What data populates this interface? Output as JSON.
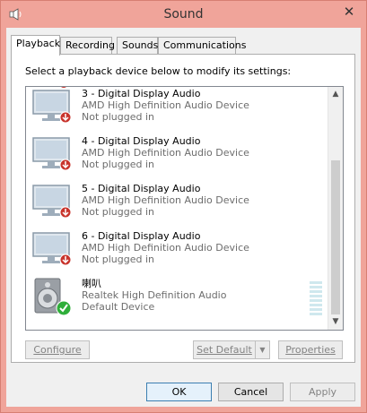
{
  "window": {
    "title": "Sound",
    "close_glyph": "✕"
  },
  "tabs": [
    {
      "label": "Playback",
      "active": true
    },
    {
      "label": "Recording"
    },
    {
      "label": "Sounds"
    },
    {
      "label": "Communications"
    }
  ],
  "instruction": "Select a playback device below to modify its settings:",
  "devices": [
    {
      "name": "3 - Digital Display Audio",
      "driver": "AMD High Definition Audio Device",
      "status": "Not plugged in",
      "icon": "monitor-icon",
      "badge": "unplugged-badge-icon"
    },
    {
      "name": "4 - Digital Display Audio",
      "driver": "AMD High Definition Audio Device",
      "status": "Not plugged in",
      "icon": "monitor-icon",
      "badge": "unplugged-badge-icon"
    },
    {
      "name": "5 - Digital Display Audio",
      "driver": "AMD High Definition Audio Device",
      "status": "Not plugged in",
      "icon": "monitor-icon",
      "badge": "unplugged-badge-icon"
    },
    {
      "name": "6 - Digital Display Audio",
      "driver": "AMD High Definition Audio Device",
      "status": "Not plugged in",
      "icon": "monitor-icon",
      "badge": "unplugged-badge-icon"
    },
    {
      "name": "喇叭",
      "driver": "Realtek High Definition Audio",
      "status": "Default Device",
      "icon": "speaker-icon",
      "badge": "default-check-icon"
    }
  ],
  "buttons": {
    "configure": "Configure",
    "set_default": "Set Default",
    "properties": "Properties",
    "ok": "OK",
    "cancel": "Cancel",
    "apply": "Apply"
  },
  "colors": {
    "title_bar": "#f0a49a",
    "unplugged_badge": "#c8342c",
    "default_check": "#2fae3a"
  }
}
